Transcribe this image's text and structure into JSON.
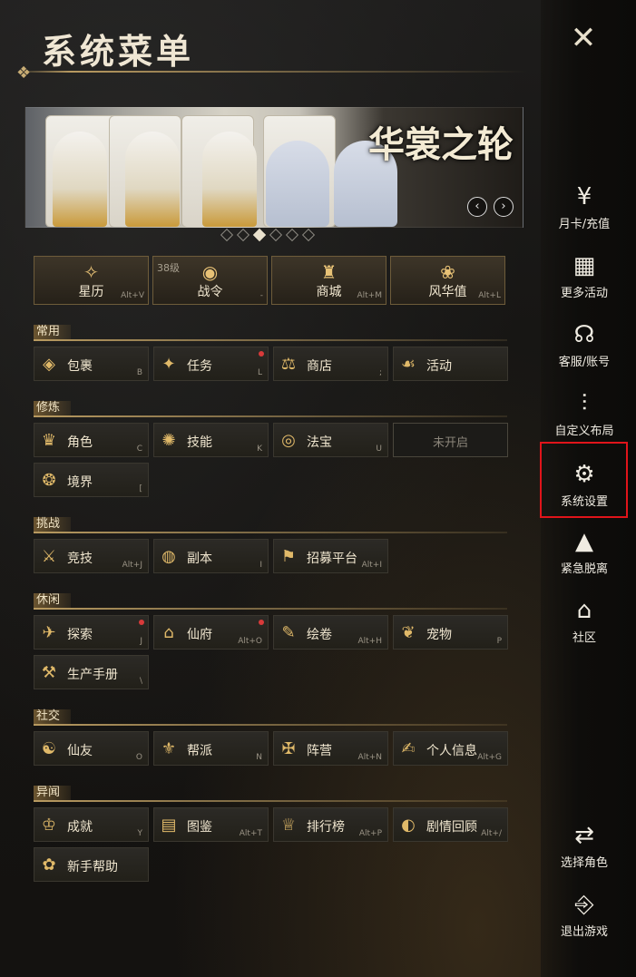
{
  "title": "系统菜单",
  "close_icon": "close-icon",
  "banner": {
    "title": "华裳之轮",
    "dots": 6,
    "active_dot": 2
  },
  "top_buttons": [
    {
      "label": "星历",
      "key": "Alt+V",
      "icon": "star-calendar-icon",
      "level": ""
    },
    {
      "label": "战令",
      "key": "-",
      "icon": "battle-pass-icon",
      "level": "38级"
    },
    {
      "label": "商城",
      "key": "Alt+M",
      "icon": "mall-icon",
      "level": ""
    },
    {
      "label": "风华值",
      "key": "Alt+L",
      "icon": "charm-icon",
      "level": ""
    }
  ],
  "sections": [
    {
      "name": "常用",
      "items": [
        {
          "label": "包裹",
          "key": "B",
          "icon": "bag-icon",
          "dot": false
        },
        {
          "label": "任务",
          "key": "L",
          "icon": "quest-icon",
          "dot": true
        },
        {
          "label": "商店",
          "key": ";",
          "icon": "shop-icon",
          "dot": false
        },
        {
          "label": "活动",
          "key": "",
          "icon": "activity-icon",
          "dot": false
        }
      ]
    },
    {
      "name": "修炼",
      "items": [
        {
          "label": "角色",
          "key": "C",
          "icon": "character-icon",
          "dot": false
        },
        {
          "label": "技能",
          "key": "K",
          "icon": "skill-icon",
          "dot": false
        },
        {
          "label": "法宝",
          "key": "U",
          "icon": "artifact-icon",
          "dot": false
        },
        {
          "label": "未开启",
          "key": "",
          "icon": "",
          "dot": false,
          "locked": true
        },
        {
          "label": "境界",
          "key": "[",
          "icon": "realm-icon",
          "dot": false
        }
      ]
    },
    {
      "name": "挑战",
      "items": [
        {
          "label": "竞技",
          "key": "Alt+J",
          "icon": "arena-icon",
          "dot": false
        },
        {
          "label": "副本",
          "key": "I",
          "icon": "dungeon-icon",
          "dot": false
        },
        {
          "label": "招募平台",
          "key": "Alt+I",
          "icon": "recruit-icon",
          "dot": false
        }
      ]
    },
    {
      "name": "休闲",
      "items": [
        {
          "label": "探索",
          "key": "J",
          "icon": "explore-icon",
          "dot": true
        },
        {
          "label": "仙府",
          "key": "Alt+O",
          "icon": "mansion-icon",
          "dot": true
        },
        {
          "label": "绘卷",
          "key": "Alt+H",
          "icon": "scroll-icon",
          "dot": false
        },
        {
          "label": "宠物",
          "key": "P",
          "icon": "pet-icon",
          "dot": false
        },
        {
          "label": "生产手册",
          "key": "\\",
          "icon": "crafting-icon",
          "dot": false
        }
      ]
    },
    {
      "name": "社交",
      "items": [
        {
          "label": "仙友",
          "key": "O",
          "icon": "friends-icon",
          "dot": false
        },
        {
          "label": "帮派",
          "key": "N",
          "icon": "guild-icon",
          "dot": false
        },
        {
          "label": "阵营",
          "key": "Alt+N",
          "icon": "faction-icon",
          "dot": false
        },
        {
          "label": "个人信息",
          "key": "Alt+G",
          "icon": "profile-icon",
          "dot": false
        }
      ]
    },
    {
      "name": "异闻",
      "items": [
        {
          "label": "成就",
          "key": "Y",
          "icon": "achievement-icon",
          "dot": false
        },
        {
          "label": "图鉴",
          "key": "Alt+T",
          "icon": "codex-icon",
          "dot": false
        },
        {
          "label": "排行榜",
          "key": "Alt+P",
          "icon": "ranking-icon",
          "dot": false
        },
        {
          "label": "剧情回顾",
          "key": "Alt+/",
          "icon": "story-review-icon",
          "dot": false
        },
        {
          "label": "新手帮助",
          "key": "",
          "icon": "help-icon",
          "dot": false
        }
      ]
    }
  ],
  "sidebar": [
    {
      "label": "月卡/充值",
      "icon": "recharge-icon"
    },
    {
      "label": "更多活动",
      "icon": "more-activities-icon"
    },
    {
      "label": "客服/账号",
      "icon": "support-icon"
    },
    {
      "label": "自定义布局",
      "icon": "layout-icon"
    },
    {
      "label": "系统设置",
      "icon": "settings-gear-icon",
      "highlighted": true
    },
    {
      "label": "紧急脱离",
      "icon": "warning-icon"
    },
    {
      "label": "社区",
      "icon": "community-home-icon"
    },
    {
      "label": "选择角色",
      "icon": "switch-character-icon"
    },
    {
      "label": "退出游戏",
      "icon": "exit-door-icon"
    }
  ],
  "colors": {
    "accent_gold": "#e0b969",
    "highlight_red": "#e0141a",
    "badge_red": "#d83a3a"
  }
}
